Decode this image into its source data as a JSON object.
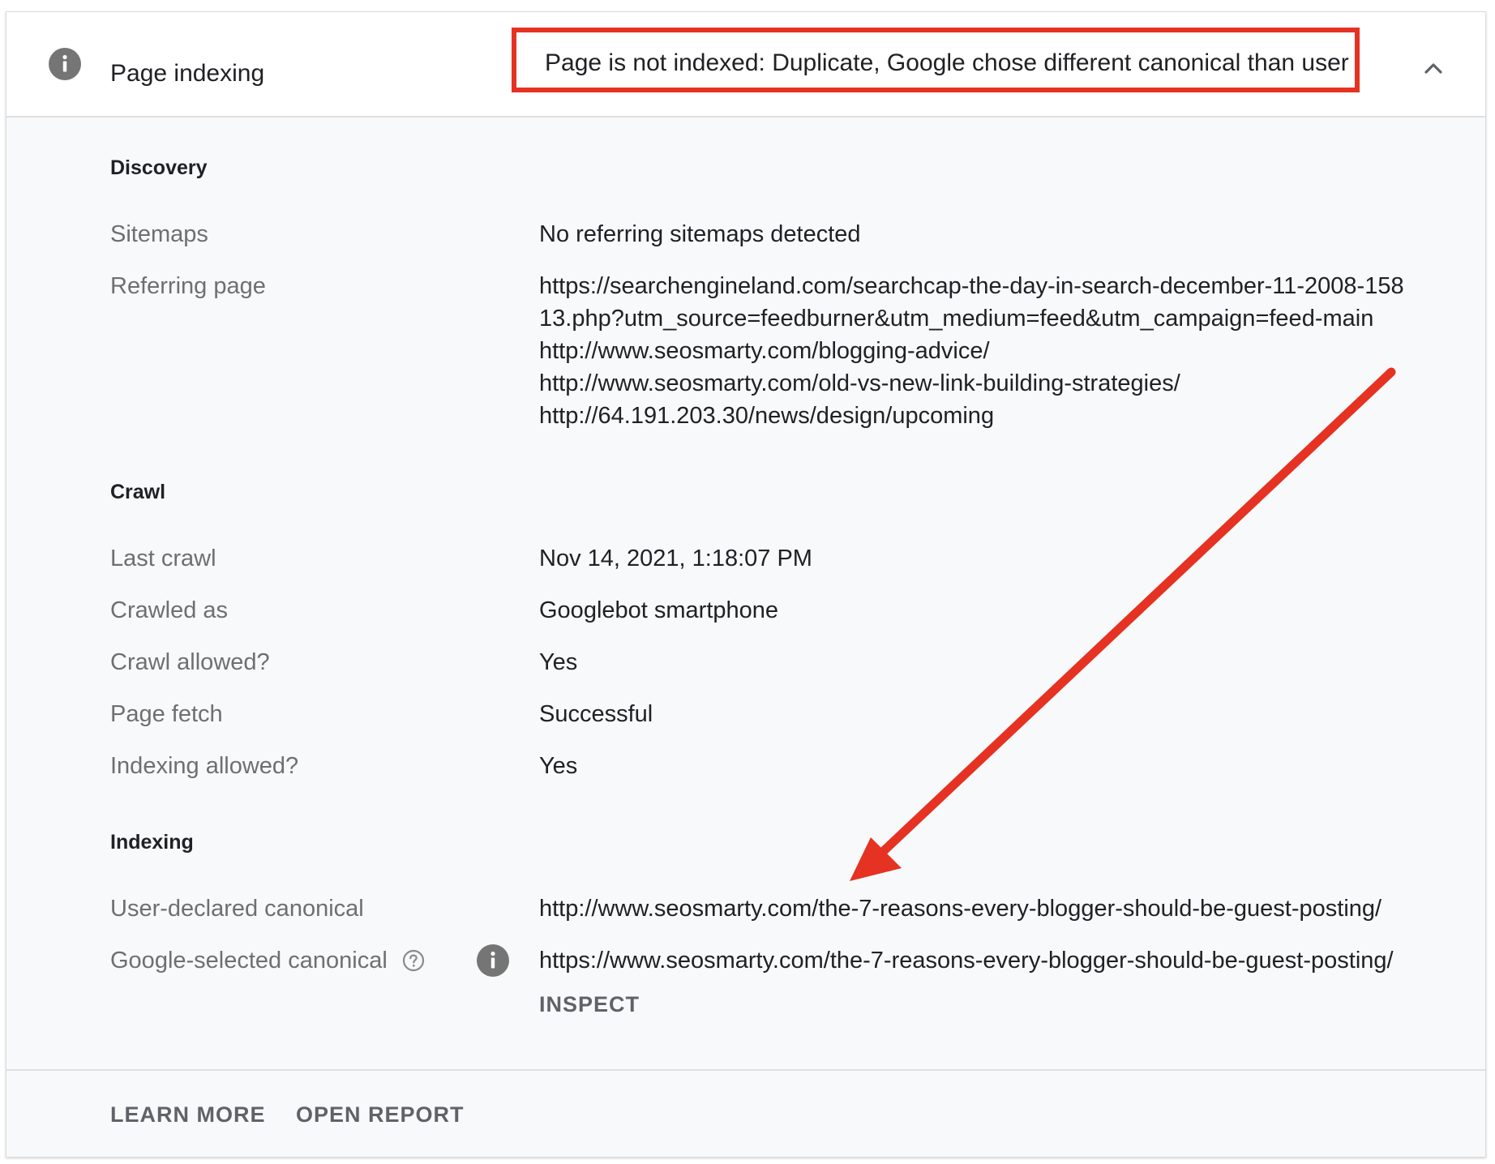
{
  "header": {
    "title": "Page indexing",
    "status": "Page is not indexed: Duplicate, Google chose different canonical than user"
  },
  "discovery": {
    "heading": "Discovery",
    "sitemaps_label": "Sitemaps",
    "sitemaps_value": "No referring sitemaps detected",
    "referring_label": "Referring page",
    "referring_pages": [
      "https://searchengineland.com/searchcap-the-day-in-search-december-11-2008-158",
      "13.php?utm_source=feedburner&utm_medium=feed&utm_campaign=feed-main",
      "http://www.seosmarty.com/blogging-advice/",
      "http://www.seosmarty.com/old-vs-new-link-building-strategies/",
      "http://64.191.203.30/news/design/upcoming"
    ]
  },
  "crawl": {
    "heading": "Crawl",
    "rows": [
      {
        "label": "Last crawl",
        "value": "Nov 14, 2021, 1:18:07 PM"
      },
      {
        "label": "Crawled as",
        "value": "Googlebot smartphone"
      },
      {
        "label": "Crawl allowed?",
        "value": "Yes"
      },
      {
        "label": "Page fetch",
        "value": "Successful"
      },
      {
        "label": "Indexing allowed?",
        "value": "Yes"
      }
    ]
  },
  "indexing": {
    "heading": "Indexing",
    "user_canonical_label": "User-declared canonical",
    "user_canonical_value": "http://www.seosmarty.com/the-7-reasons-every-blogger-should-be-guest-posting/",
    "google_canonical_label": "Google-selected canonical",
    "google_canonical_value": "https://www.seosmarty.com/the-7-reasons-every-blogger-should-be-guest-posting/",
    "inspect_label": "INSPECT"
  },
  "footer": {
    "learn_more": "LEARN MORE",
    "open_report": "OPEN REPORT"
  },
  "colors": {
    "annotation_red": "#e53222",
    "label_gray": "#6f6f6f",
    "icon_gray": "#757575",
    "link_gray": "#5f6368"
  },
  "icons": [
    "info-icon",
    "chevron-up-icon",
    "help-icon"
  ]
}
